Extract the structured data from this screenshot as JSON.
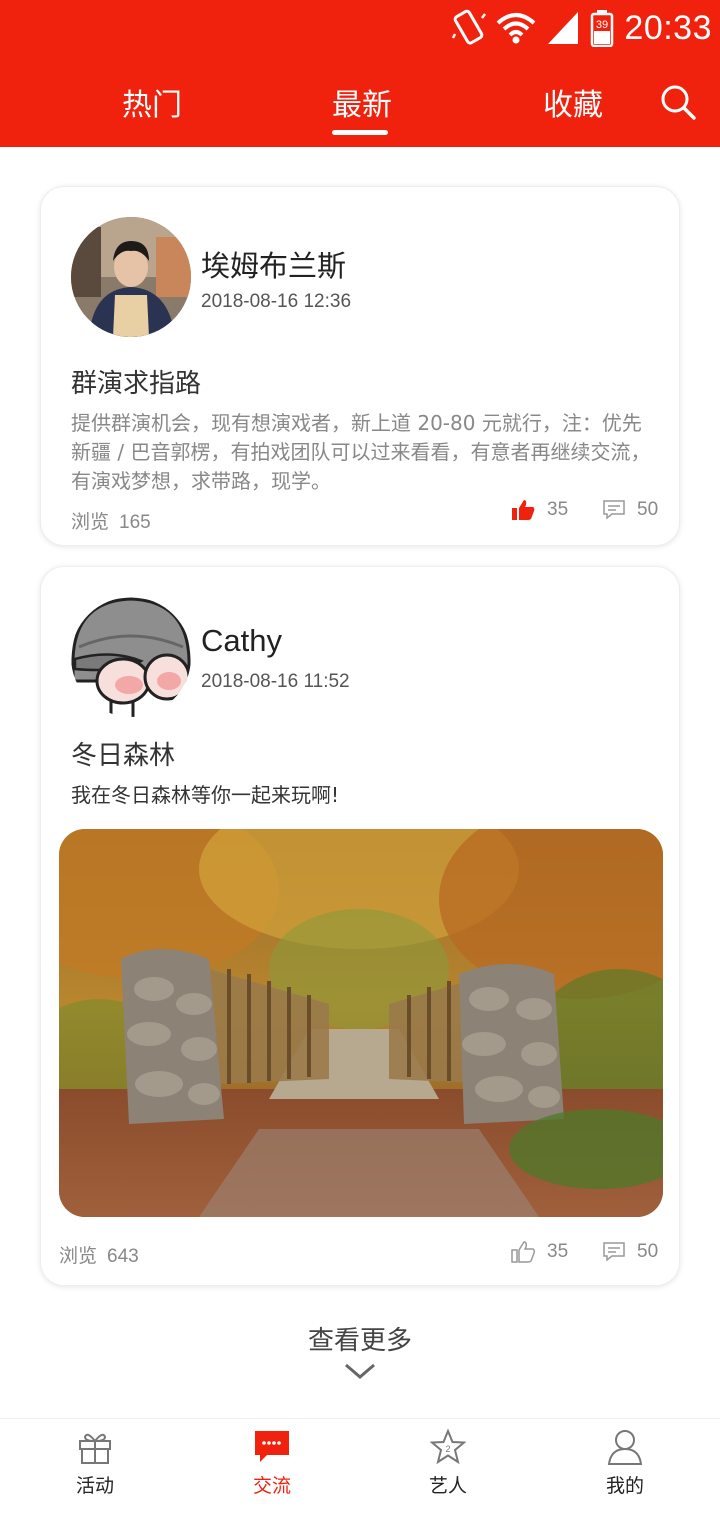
{
  "status_bar": {
    "time": "20:33",
    "battery": "39"
  },
  "top_tabs": {
    "hot": "热门",
    "latest": "最新",
    "favorites": "收藏",
    "active": "latest"
  },
  "posts": [
    {
      "username": "埃姆布兰斯",
      "time": "2018-08-16 12:36",
      "title": "群演求指路",
      "body": "提供群演机会，现有想演戏者，新上道 20-80 元就行，注：优先新疆 / 巴音郭楞，有拍戏团队可以过来看看，有意者再继续交流，有演戏梦想，求带路，现学。",
      "views_label": "浏览",
      "views": "165",
      "likes": "35",
      "comments": "50",
      "liked": true
    },
    {
      "username": "Cathy",
      "time": "2018-08-16 11:52",
      "title": "冬日森林",
      "body": "我在冬日森林等你一起来玩啊!",
      "views_label": "浏览",
      "views": "643",
      "likes": "35",
      "comments": "50",
      "liked": false
    }
  ],
  "more": {
    "label": "查看更多"
  },
  "bottom_nav": [
    {
      "label": "活动",
      "icon": "gift-icon"
    },
    {
      "label": "交流",
      "icon": "chat-icon",
      "active": true
    },
    {
      "label": "艺人",
      "icon": "star-icon"
    },
    {
      "label": "我的",
      "icon": "user-icon"
    }
  ],
  "colors": {
    "brand": "#f0220e",
    "muted": "#888888"
  }
}
